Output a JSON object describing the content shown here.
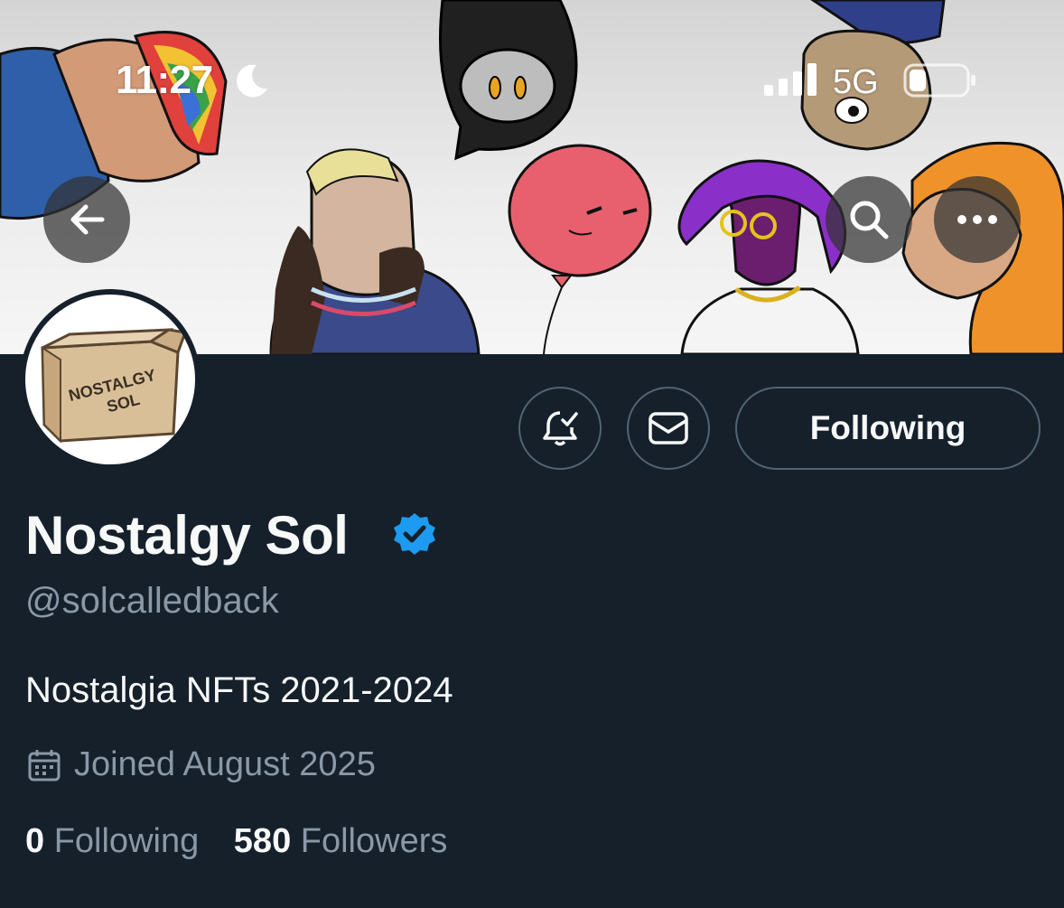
{
  "status_bar": {
    "time": "11:27",
    "network": "5G",
    "moon_icon": "moon-icon",
    "signal_icon": "signal-icon",
    "battery_icon": "battery-icon"
  },
  "header": {
    "back_icon": "arrow-left-icon",
    "search_icon": "search-icon",
    "more_icon": "more-horizontal-icon"
  },
  "avatar": {
    "text_line1": "NOSTALGY",
    "text_line2": "SOL"
  },
  "actions": {
    "notify_icon": "bell-check-icon",
    "message_icon": "envelope-icon",
    "following_label": "Following"
  },
  "profile": {
    "display_name": "Nostalgy Sol",
    "verified_color": "#1d9bf0",
    "handle": "@solcalledback",
    "bio": "Nostalgia NFTs 2021-2024",
    "joined": "Joined August 2025",
    "following_count": "0",
    "following_label": "Following",
    "followers_count": "580",
    "followers_label": "Followers"
  },
  "colors": {
    "background": "#15202b",
    "text_primary": "#f7f9f9",
    "text_secondary": "#8b98a5",
    "border": "#536471",
    "accent": "#1d9bf0"
  }
}
